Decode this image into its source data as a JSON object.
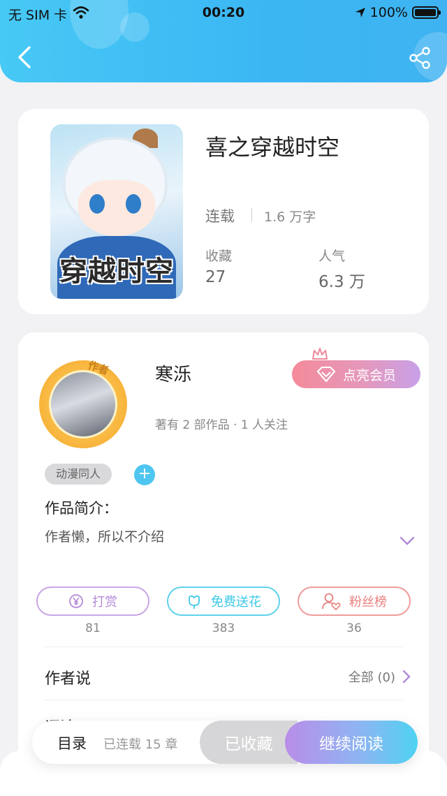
{
  "status_bar": {
    "carrier": "无 SIM 卡",
    "time": "00:20",
    "battery": "100%"
  },
  "book": {
    "cover_text": "穿越时空",
    "title": "喜之穿越时空",
    "status": "连载",
    "word_count": "1.6 万字",
    "stats": [
      {
        "label": "收藏",
        "value": "27"
      },
      {
        "label": "人气",
        "value": "6.3 万"
      }
    ]
  },
  "author": {
    "avatar_tag": "作者",
    "name": "寒泺",
    "member_button": "点亮会员",
    "meta": "著有 2 部作品 · 1 人关注",
    "tags": [
      "动漫同人"
    ],
    "add_tag": "+",
    "intro_label": "作品简介：",
    "intro_text": "作者懒，所以不介绍"
  },
  "actions": [
    {
      "label": "打赏",
      "count": "81",
      "color": "#b58ad8"
    },
    {
      "label": "免费送花",
      "count": "383",
      "color": "#3cc8e6"
    },
    {
      "label": "粉丝榜",
      "count": "36",
      "color": "#e9817f"
    }
  ],
  "author_says": {
    "label": "作者说",
    "all_link": "全部 (0)"
  },
  "partial_row": "评论",
  "bottom_bar": {
    "toc": "目录",
    "toc_info": "已连载 15 章",
    "collected": "已收藏",
    "continue": "继续阅读"
  }
}
